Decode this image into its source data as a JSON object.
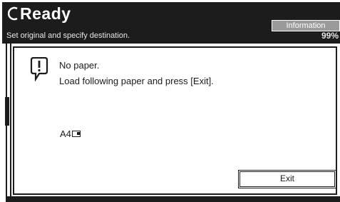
{
  "header": {
    "status_title": "Ready",
    "subtitle": "Set original and specify destination.",
    "info_button_label": "Information",
    "memory_percent": "99%"
  },
  "dialog": {
    "message_line1": "No paper.",
    "message_line2": "Load following paper and press [Exit].",
    "paper_size": "A4",
    "exit_button_label": "Exit",
    "icon": "alert-icon"
  },
  "colors": {
    "panel_dark": "#1c1c1c",
    "button_grey": "#9a9a9a",
    "background": "#ffffff"
  }
}
